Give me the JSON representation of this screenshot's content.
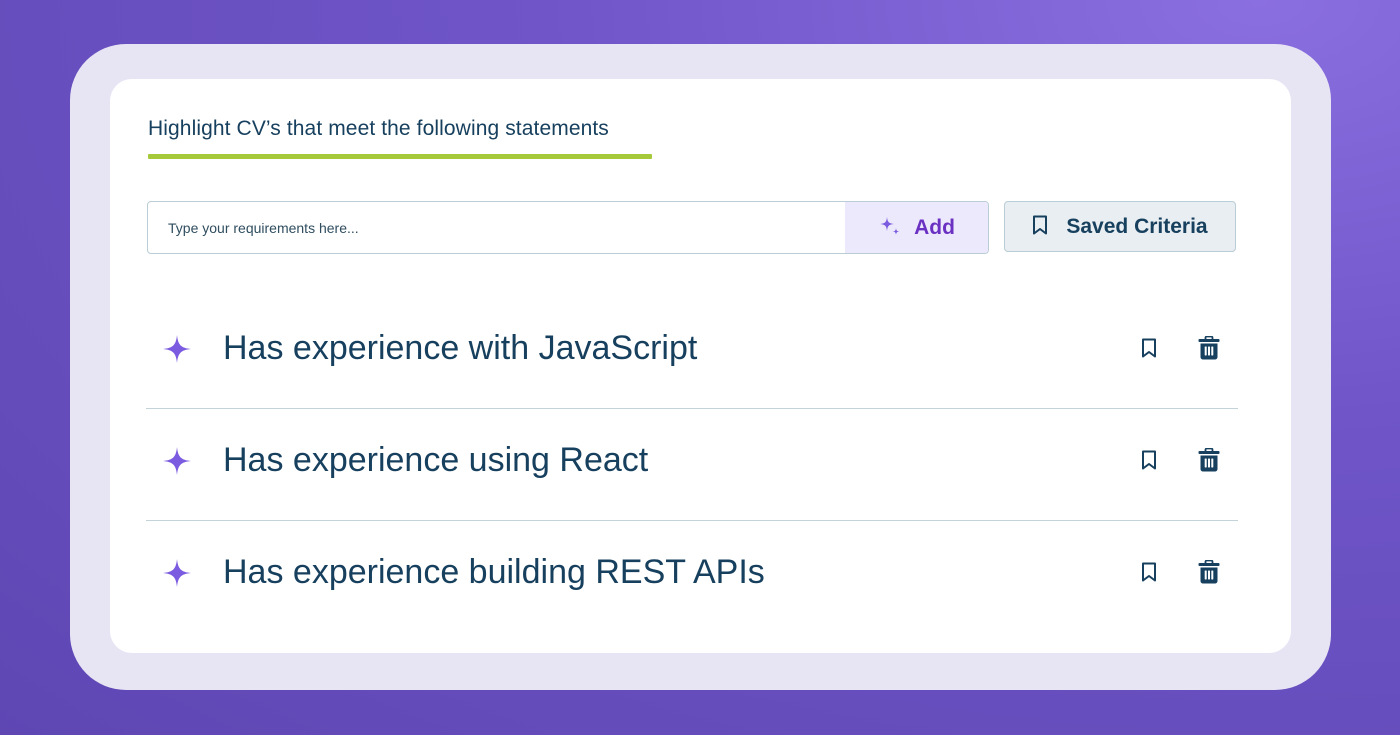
{
  "header": {
    "title": "Highlight CV’s that meet the following statements"
  },
  "input": {
    "placeholder": "Type your requirements here...",
    "value": ""
  },
  "add_button": {
    "label": "Add",
    "icon": "sparkles-icon"
  },
  "saved_button": {
    "label": "Saved Criteria",
    "icon": "bookmark-icon"
  },
  "criteria": [
    {
      "text": "Has experience with JavaScript",
      "icon": "sparkle-icon"
    },
    {
      "text": "Has experience using React",
      "icon": "sparkle-icon"
    },
    {
      "text": "Has experience building REST APIs",
      "icon": "sparkle-icon"
    }
  ],
  "colors": {
    "accent": "#7b5be0",
    "underline": "#a6c93a",
    "text": "#17405e",
    "add_text": "#6b31c2"
  }
}
